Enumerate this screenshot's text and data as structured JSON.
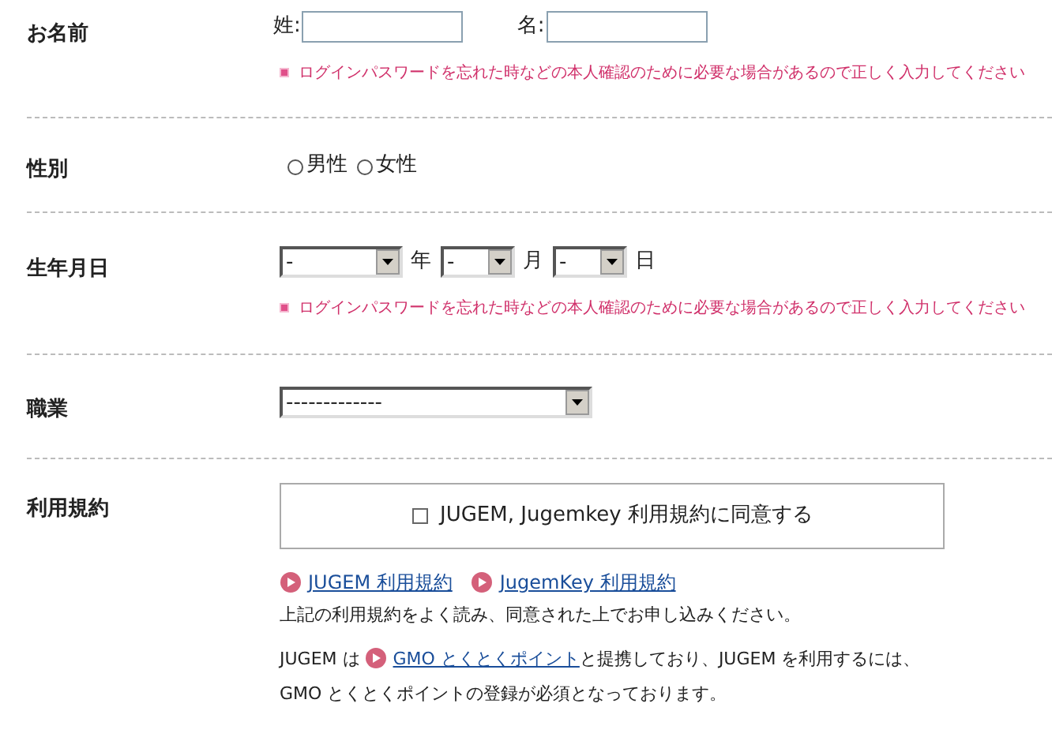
{
  "name": {
    "label": "お名前",
    "fields": [
      {
        "label": "姓:"
      },
      {
        "label": "名:"
      }
    ],
    "note": "ログインパスワードを忘れた時などの本人確認のために必要な場合があるので正しく入力してください"
  },
  "gender": {
    "label": "性別",
    "options": [
      {
        "label": "男性",
        "selected": false
      },
      {
        "label": "女性",
        "selected": false
      }
    ]
  },
  "birthdate": {
    "label": "生年月日",
    "selects": [
      {
        "value": "-",
        "unit": "年"
      },
      {
        "value": "-",
        "unit": "月"
      },
      {
        "value": "-",
        "unit": "日"
      }
    ],
    "note": "ログインパスワードを忘れた時などの本人確認のために必要な場合があるので正しく入力してください"
  },
  "occupation": {
    "label": "職業",
    "value": "-------------"
  },
  "terms": {
    "label": "利用規約",
    "agree": {
      "label": "JUGEM, Jugemkey 利用規約に同意する",
      "checked": false
    },
    "links": [
      "JUGEM 利用規約",
      "JugemKey 利用規約"
    ],
    "instruction": "上記の利用規約をよく読み、同意された上でお申し込みください。",
    "partner": {
      "prefix": "JUGEM は",
      "link": "GMO とくとくポイント",
      "suffix": "と提携しており、JUGEM を利用するには、",
      "line2": "GMO とくとくポイントの登録が必須となっております。"
    }
  }
}
